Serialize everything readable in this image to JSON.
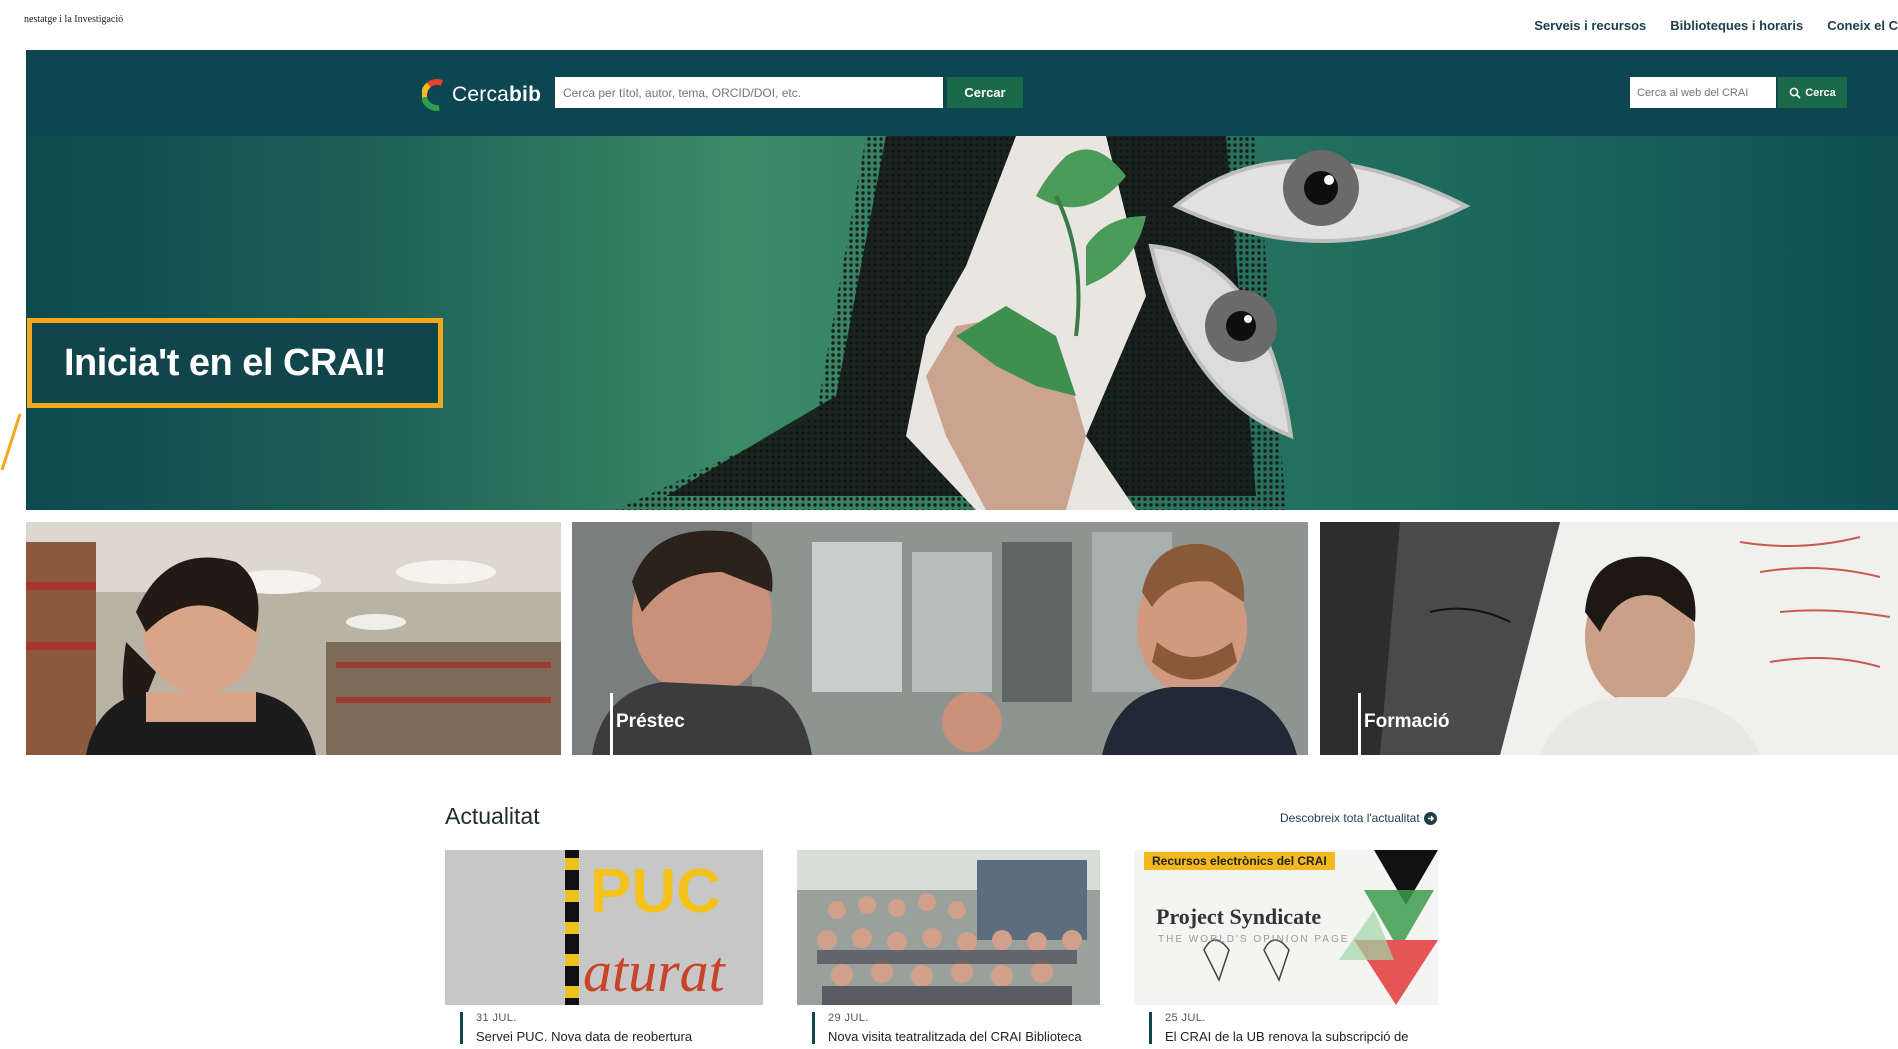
{
  "top_bar": {
    "cropped_title": "nestatge i la Investigació",
    "links": [
      "Serveis i recursos",
      "Biblioteques i horaris",
      "Coneix el C"
    ]
  },
  "header": {
    "logo": {
      "prefix": "Cerca",
      "suffix": "bib"
    },
    "main_search": {
      "placeholder": "Cerca per títol, autor, tema, ORCID/DOI, etc.",
      "button_label": "Cercar"
    },
    "web_search": {
      "placeholder": "Cerca al web del CRAI",
      "button_label": "Cerca"
    }
  },
  "hero": {
    "title": "Inicia't en el CRAI!"
  },
  "cards": [
    {
      "label": ""
    },
    {
      "label": "Préstec"
    },
    {
      "label": "Formació"
    }
  ],
  "news": {
    "section_title": "Actualitat",
    "more_link": "Descobreix tota l'actualitat",
    "items": [
      {
        "date": "31 JUL.",
        "headline": "Servei PUC. Nova data de reobertura",
        "image_text_1": "PUC",
        "image_text_2": "aturat"
      },
      {
        "date": "29 JUL.",
        "headline": "Nova visita teatralitzada del CRAI Biblioteca"
      },
      {
        "date": "25 JUL.",
        "headline": "El CRAI de la UB renova la subscripció de",
        "image_banner": "Recursos electrònics del CRAI",
        "image_title": "Project Syndicate",
        "image_subtitle": "THE WORLD'S OPINION PAGE"
      }
    ]
  },
  "colors": {
    "header_bg": "#0d4650",
    "button_green": "#1a6a4a",
    "highlight_orange": "#f2a81d"
  }
}
